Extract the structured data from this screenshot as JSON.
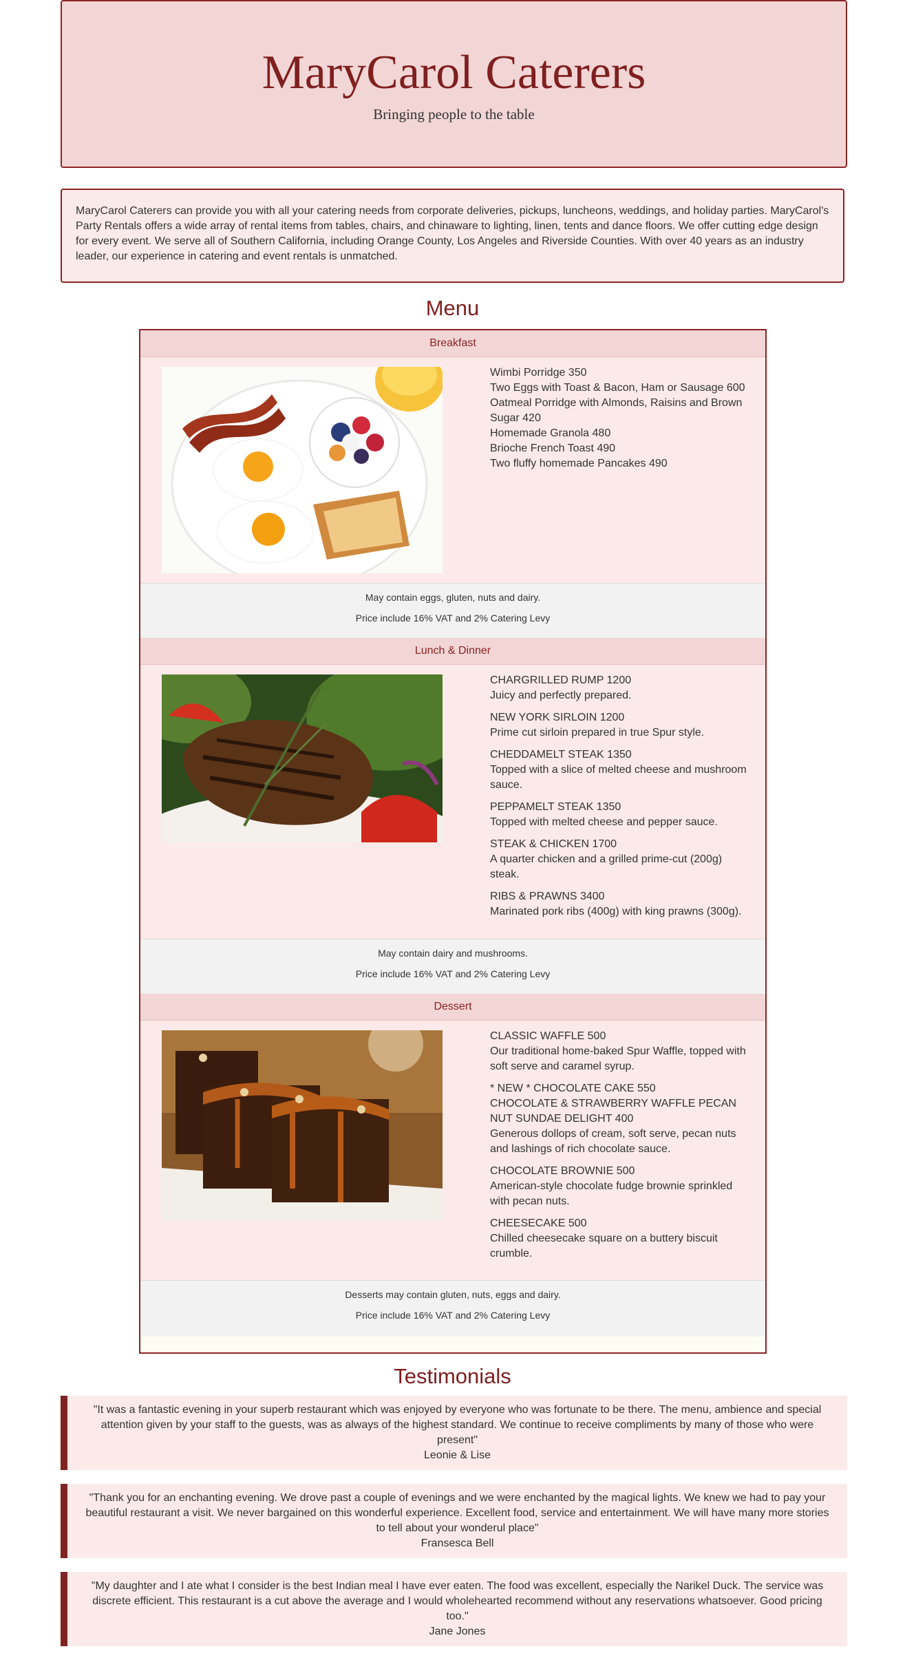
{
  "header": {
    "title": "MaryCarol Caterers",
    "tagline": "Bringing people to the table"
  },
  "about": {
    "text": "MaryCarol Caterers can provide you with all your catering needs from corporate deliveries, pickups, luncheons, weddings, and holiday parties. MaryCarol's Party Rentals offers a wide array of rental items from tables, chairs, and chinaware to lighting, linen, tents and dance floors. We offer cutting edge design for every event. We serve all of Southern California, including Orange County, Los Angeles and Riverside Counties. With over 40 years as an industry leader, our experience in catering and event rentals is unmatched."
  },
  "menu": {
    "heading": "Menu",
    "breakfast": {
      "title": "Breakfast",
      "items": [
        "Wimbi Porridge 350",
        "Two Eggs with Toast & Bacon, Ham or Sausage 600",
        "Oatmeal Porridge with Almonds, Raisins and Brown Sugar 420",
        "Homemade Granola 480",
        "Brioche French Toast 490",
        "Two fluffy homemade Pancakes 490"
      ],
      "note": "May contain eggs, gluten, nuts and dairy.",
      "price_note": "Price include 16% VAT and 2% Catering Levy"
    },
    "lunch": {
      "title": "Lunch & Dinner",
      "items": [
        {
          "name": "CHARGRILLED RUMP 1200",
          "desc": "Juicy and perfectly prepared."
        },
        {
          "name": "NEW YORK SIRLOIN 1200",
          "desc": "Prime cut sirloin prepared in true Spur style."
        },
        {
          "name": "CHEDDAMELT STEAK 1350",
          "desc": "Topped with a slice of melted cheese and mushroom sauce."
        },
        {
          "name": "PEPPAMELT STEAK 1350",
          "desc": "Topped with melted cheese and pepper sauce."
        },
        {
          "name": "STEAK & CHICKEN 1700",
          "desc": "A quarter chicken and a grilled prime-cut (200g) steak."
        },
        {
          "name": "RIBS & PRAWNS 3400",
          "desc": "Marinated pork ribs (400g) with king prawns (300g)."
        }
      ],
      "note": "May contain dairy and mushrooms.",
      "price_note": "Price include 16% VAT and 2% Catering Levy"
    },
    "dessert": {
      "title": "Dessert",
      "items": [
        {
          "name": "CLASSIC WAFFLE 500",
          "desc": "Our traditional home-baked Spur Waffle, topped with soft serve and caramel syrup."
        },
        {
          "name": "* NEW * CHOCOLATE CAKE 550",
          "desc": ""
        },
        {
          "name": "CHOCOLATE & STRAWBERRY WAFFLE PECAN NUT SUNDAE DELIGHT 400",
          "desc": "Generous dollops of cream, soft serve, pecan nuts and lashings of rich chocolate sauce."
        },
        {
          "name": "CHOCOLATE BROWNIE 500",
          "desc": "American-style chocolate fudge brownie sprinkled with pecan nuts."
        },
        {
          "name": "CHEESECAKE 500",
          "desc": "Chilled cheesecake square on a buttery biscuit crumble."
        }
      ],
      "note": "Desserts may contain gluten, nuts, eggs and dairy.",
      "price_note": "Price include 16% VAT and 2% Catering Levy"
    }
  },
  "testimonials": {
    "heading": "Testimonials",
    "items": [
      {
        "quote": "\"It was a fantastic evening in your superb restaurant which was enjoyed by everyone who was fortunate to be there. The menu, ambience and special attention given by your staff to the guests, was as always of the highest standard. We continue to receive compliments by many of those who were present\"",
        "author": "Leonie & Lise"
      },
      {
        "quote": "\"Thank you for an enchanting evening. We drove past a couple of evenings and we were enchanted by the magical lights. We knew we had to pay your beautiful restaurant a visit. We never bargained on this wonderful experience. Excellent food, service and entertainment. We will have many more stories to tell about your wonderul place\"",
        "author": "Fransesca Bell"
      },
      {
        "quote": "\"My daughter and I ate what I consider is the best Indian meal I have ever eaten. The food was excellent, especially the Narikel Duck. The service was discrete efficient. This restaurant is a cut above the average and I would wholehearted recommend without any reservations whatsoever. Good pricing too.\"",
        "author": "Jane Jones"
      }
    ]
  },
  "colors": {
    "brand": "#7f1f1f",
    "header_bg": "#f2d5d5",
    "panel_bg": "#fceaea"
  }
}
